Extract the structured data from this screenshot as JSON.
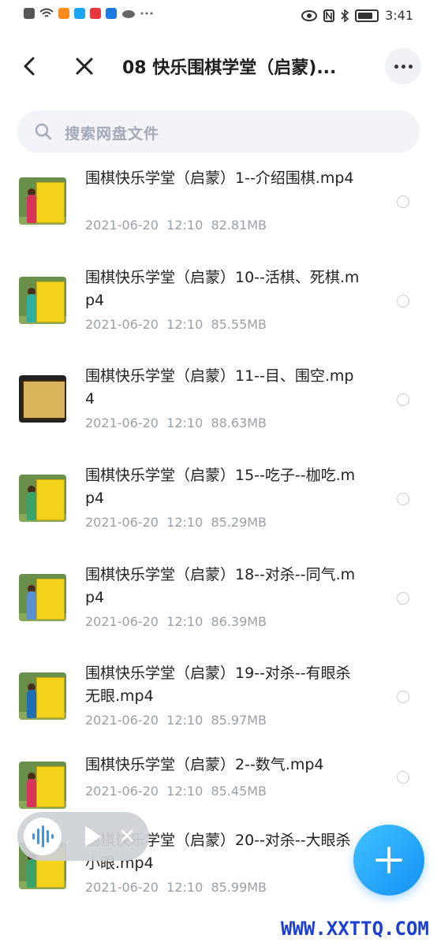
{
  "status_bar": {
    "time": "3:41",
    "left_icons": [
      "alert-icon",
      "wifi-icon",
      "play-app-icon",
      "search-app-icon",
      "red-app-icon",
      "bulb-app-icon",
      "cloud-icon",
      "more-dots-icon"
    ],
    "right_icons": [
      "eye-icon",
      "nfc-icon",
      "bluetooth-icon",
      "battery-icon"
    ]
  },
  "nav": {
    "title": "08 快乐围棋学堂（启蒙)..."
  },
  "search": {
    "placeholder": "搜索网盘文件"
  },
  "files": [
    {
      "name": "围棋快乐学堂（启蒙）1--介绍围棋.mp4",
      "date": "2021-06-20",
      "time": "12:10",
      "size": "82.81MB"
    },
    {
      "name": "围棋快乐学堂（启蒙）10--活棋、死棋.mp4",
      "date": "2021-06-20",
      "time": "12:10",
      "size": "85.55MB"
    },
    {
      "name": "围棋快乐学堂（启蒙）11--目、围空.mp4",
      "date": "2021-06-20",
      "time": "12:10",
      "size": "88.63MB"
    },
    {
      "name": "围棋快乐学堂（启蒙）15--吃子--枷吃.mp4",
      "date": "2021-06-20",
      "time": "12:10",
      "size": "85.29MB"
    },
    {
      "name": "围棋快乐学堂（启蒙）18--对杀--同气.mp4",
      "date": "2021-06-20",
      "time": "12:10",
      "size": "86.39MB"
    },
    {
      "name": "围棋快乐学堂（启蒙）19--对杀--有眼杀无眼.mp4",
      "date": "2021-06-20",
      "time": "12:10",
      "size": "85.97MB"
    },
    {
      "name": "围棋快乐学堂（启蒙）2--数气.mp4",
      "date": "2021-06-20",
      "time": "12:10",
      "size": "85.45MB"
    },
    {
      "name": "围棋快乐学堂（启蒙）20--对杀--大眼杀小眼.mp4",
      "date": "2021-06-20",
      "time": "12:10",
      "size": "85.99MB"
    }
  ],
  "watermark": "WWW.XXTTQ.COM",
  "colors": {
    "accent": "#1691f5",
    "meta_text": "#9aa0ab",
    "search_bg": "#f1f3f8"
  }
}
